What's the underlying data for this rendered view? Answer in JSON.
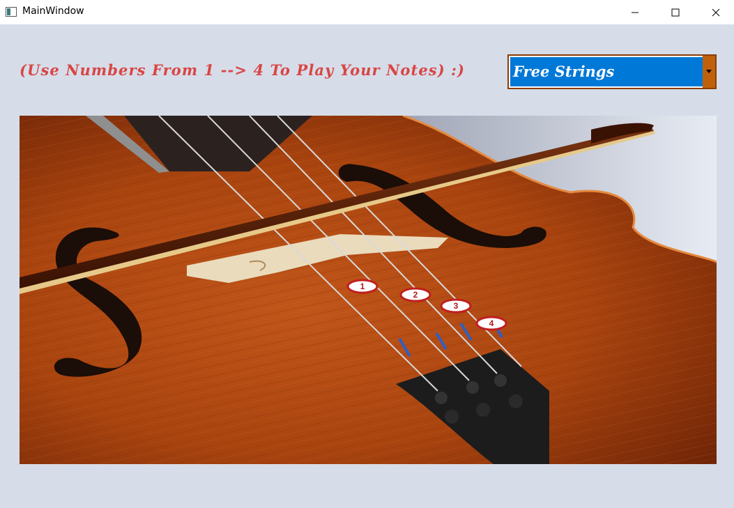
{
  "window": {
    "title": "MainWindow",
    "icon": "app-window-icon",
    "controls": [
      "minimize-icon",
      "maximize-icon",
      "close-icon"
    ]
  },
  "main": {
    "hint": "(Use Numbers From 1 --> 4 To Play Your Notes)  :)",
    "mode_select": {
      "selected": "Free Strings"
    }
  },
  "image": {
    "description_icon": "cello-image",
    "string_markers": [
      "1",
      "2",
      "3",
      "4"
    ]
  },
  "colors": {
    "background": "#d6dde8",
    "hint_text": "#d94545",
    "combo_fill": "#0078d7",
    "combo_border": "#8a3d04"
  }
}
